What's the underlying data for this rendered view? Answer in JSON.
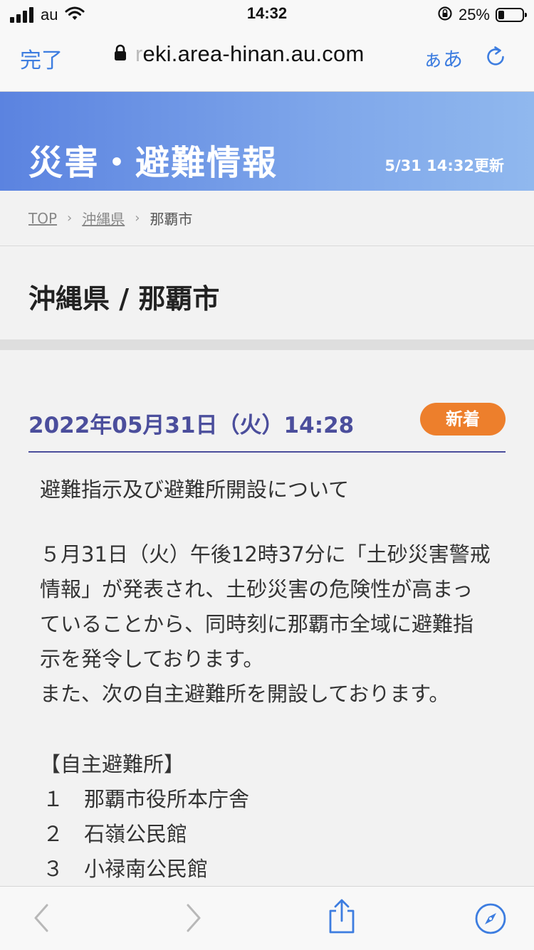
{
  "status_bar": {
    "carrier": "au",
    "time": "14:32",
    "battery_percent": "25%",
    "battery_level": 0.25,
    "icons": [
      "signal-icon",
      "wifi-icon",
      "orientation-lock-icon",
      "battery-icon"
    ]
  },
  "url_bar": {
    "done_label": "完了",
    "url_fade": "r",
    "url_main": "eki.area-hinan.au.com",
    "text_size_label": "ぁあ",
    "icons": [
      "lock-icon",
      "reload-icon"
    ],
    "accent_color": "#3d7de0"
  },
  "banner": {
    "title": "災害・避難情報",
    "updated": "5/31 14:32更新"
  },
  "breadcrumb": {
    "items": [
      "TOP",
      "沖縄県",
      "那覇市"
    ]
  },
  "page": {
    "title": "沖縄県 / 那覇市"
  },
  "notice": {
    "date": "2022年05月31日（火）14:28",
    "badge": "新着",
    "badge_color": "#ed7f2c",
    "heading_color": "#4b4e9c",
    "subject": "避難指示及び避難所開設について",
    "paragraph_lines": [
      "５月31日（火）午後12時37分に「土砂災害警戒",
      "情報」が発表され、土砂災害の危険性が高まっ",
      "ていることから、同時刻に那覇市全域に避難指",
      "示を発令しております。",
      "また、次の自主避難所を開設しております。"
    ],
    "shelters_heading": "【自主避難所】",
    "shelters": [
      {
        "num": "１",
        "name": "那覇市役所本庁舎"
      },
      {
        "num": "２",
        "name": "石嶺公民館"
      },
      {
        "num": "３",
        "name": "小禄南公民館"
      }
    ]
  },
  "toolbar": {
    "icons": [
      "back-icon",
      "forward-icon",
      "share-icon",
      "compass-icon"
    ]
  }
}
